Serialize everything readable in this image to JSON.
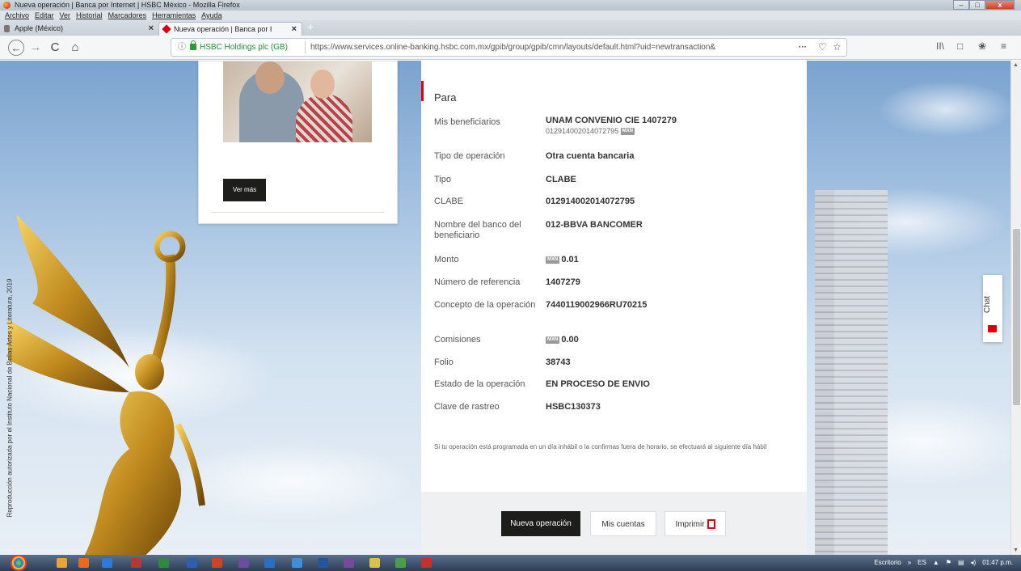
{
  "window": {
    "title": "Nueva operación | Banca por Internet | HSBC México - Mozilla Firefox",
    "minimize": "–",
    "maximize": "□",
    "close": "x"
  },
  "menu": [
    "Archivo",
    "Editar",
    "Ver",
    "Historial",
    "Marcadores",
    "Herramientas",
    "Ayuda"
  ],
  "tabs": [
    {
      "label": "Apple (México)",
      "close": "×"
    },
    {
      "label": "Nueva operación | Banca por I",
      "close": "×"
    }
  ],
  "newtab_label": "+",
  "nav": {
    "back": "←",
    "forward": "→",
    "reload": "C",
    "home": "⌂",
    "site_identity": "HSBC Holdings plc (GB)",
    "url": "https://www.services.online-banking.hsbc.com.mx/gpib/group/gpib/cmn/layouts/default.html?uid=newtransaction&",
    "more": "···",
    "pocket": "♡",
    "star": "☆",
    "library": "II\\",
    "sidebar": "□",
    "account": "❀",
    "menu": "≡"
  },
  "promo": {
    "button_label": "Ver más"
  },
  "photo_credit": "Reproducción autorizada por el Instituto Nacional de Bellas Artes y Literatura, 2019",
  "transaction": {
    "section_title": "Para",
    "rows": [
      {
        "label": "Mis beneficiarios",
        "value": "UNAM CONVENIO CIE 1407279",
        "sub": "012914002014072795",
        "sub_badge": "MXN"
      },
      {
        "label": "Tipo de operación",
        "value": "Otra cuenta bancaria"
      },
      {
        "label": "Tipo",
        "value": "CLABE"
      },
      {
        "label": "CLABE",
        "value": "012914002014072795"
      },
      {
        "label": "Nombre del banco del beneficiario",
        "value": "012-BBVA BANCOMER"
      },
      {
        "label": "Monto",
        "value": "0.01",
        "badge": "MXN"
      },
      {
        "label": "Número de referencia",
        "value": "1407279"
      },
      {
        "label": "Concepto de la operación",
        "value": "7440119002966RU70215"
      },
      {
        "label": "Comisiones",
        "value": "0.00",
        "badge": "MXN"
      },
      {
        "label": "Folio",
        "value": "38743"
      },
      {
        "label": "Estado de la operación",
        "value": "EN PROCESO DE ENVIO"
      },
      {
        "label": "Clave de rastreo",
        "value": "HSBC130373"
      }
    ],
    "disclaimer": "Si tu operación está programada en un día inhábil o la confirmas fuera de horario, se efectuará al siguiente día hábil"
  },
  "actions": {
    "nueva": "Nueva operación",
    "cuentas": "Mis cuentas",
    "imprimir": "Imprimir"
  },
  "chat_label": "Chat",
  "taskbar": {
    "tray_desktop": "Escritorio",
    "tray_chevron": "»",
    "tray_lang": "ES",
    "tray_clock": "01:47 p.m."
  },
  "colors": {
    "brand": "#db0011",
    "dark_button": "#1d1d1b"
  }
}
